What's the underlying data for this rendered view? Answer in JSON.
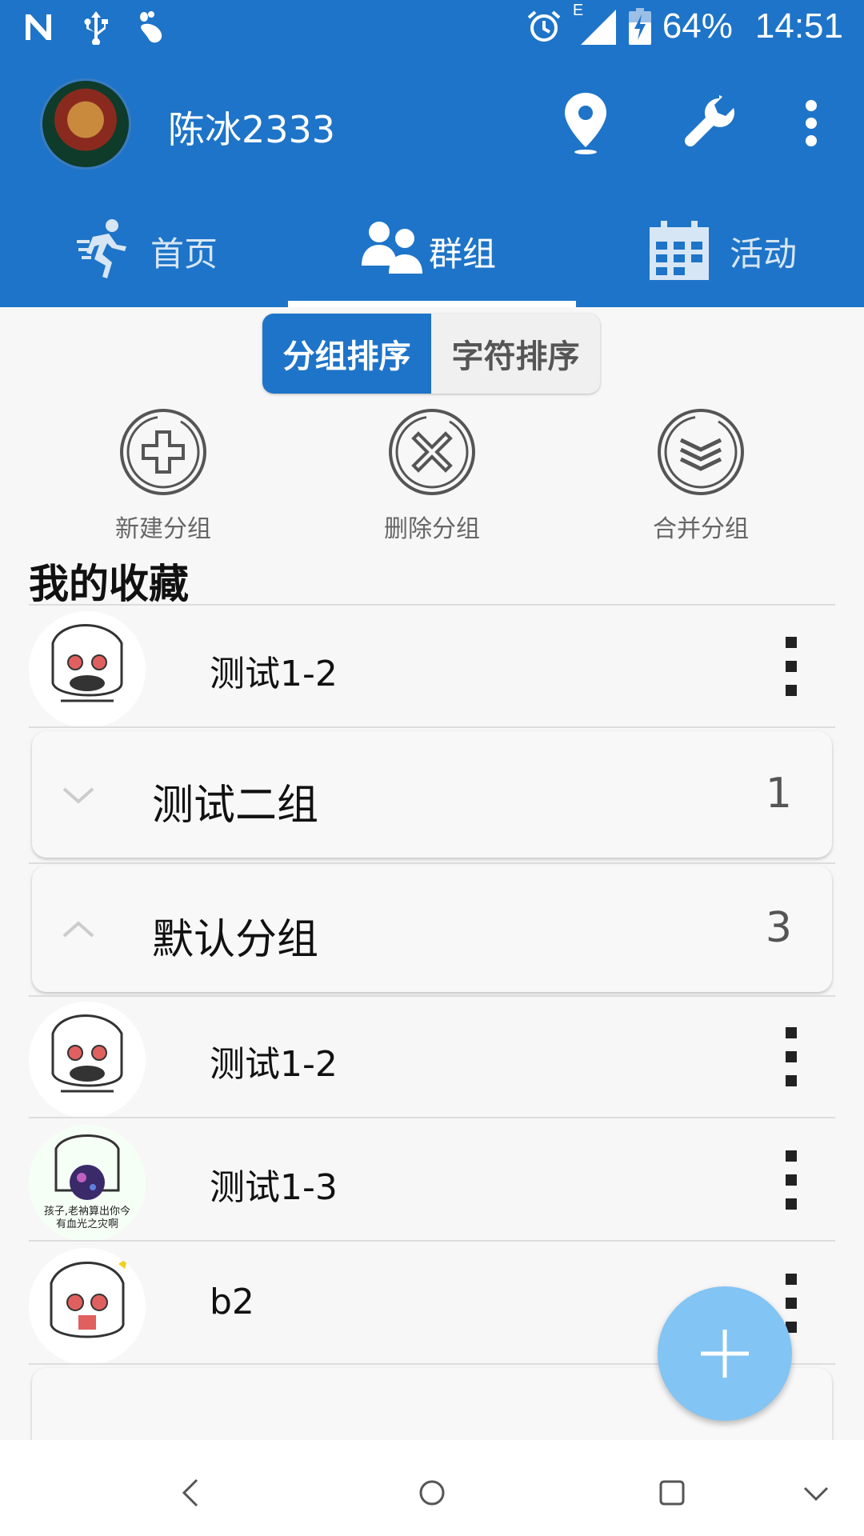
{
  "status": {
    "network_type": "E",
    "battery": "64%",
    "time": "14:51"
  },
  "appbar": {
    "username": "陈冰2333"
  },
  "tabs": [
    {
      "label": "首页",
      "active": false
    },
    {
      "label": "群组",
      "active": true
    },
    {
      "label": "活动",
      "active": false
    }
  ],
  "sort": {
    "by_group": "分组排序",
    "by_char": "字符排序",
    "selected": "分组排序"
  },
  "actions": {
    "new_group": "新建分组",
    "delete_group": "删除分组",
    "merge_group": "合并分组"
  },
  "favorites": {
    "title": "我的收藏",
    "items": [
      {
        "name": "测试1-2"
      }
    ]
  },
  "groups": [
    {
      "name": "测试二组",
      "count": "1",
      "expanded": false
    },
    {
      "name": "默认分组",
      "count": "3",
      "expanded": true
    }
  ],
  "default_members": [
    {
      "name": "测试1-2"
    },
    {
      "name": "测试1-3",
      "caption_line1": "孩子,老衲算出你今",
      "caption_line2": "有血光之灾啊"
    },
    {
      "name": "b2"
    }
  ],
  "colors": {
    "primary": "#1e74c8",
    "fab": "#82c4f4"
  }
}
